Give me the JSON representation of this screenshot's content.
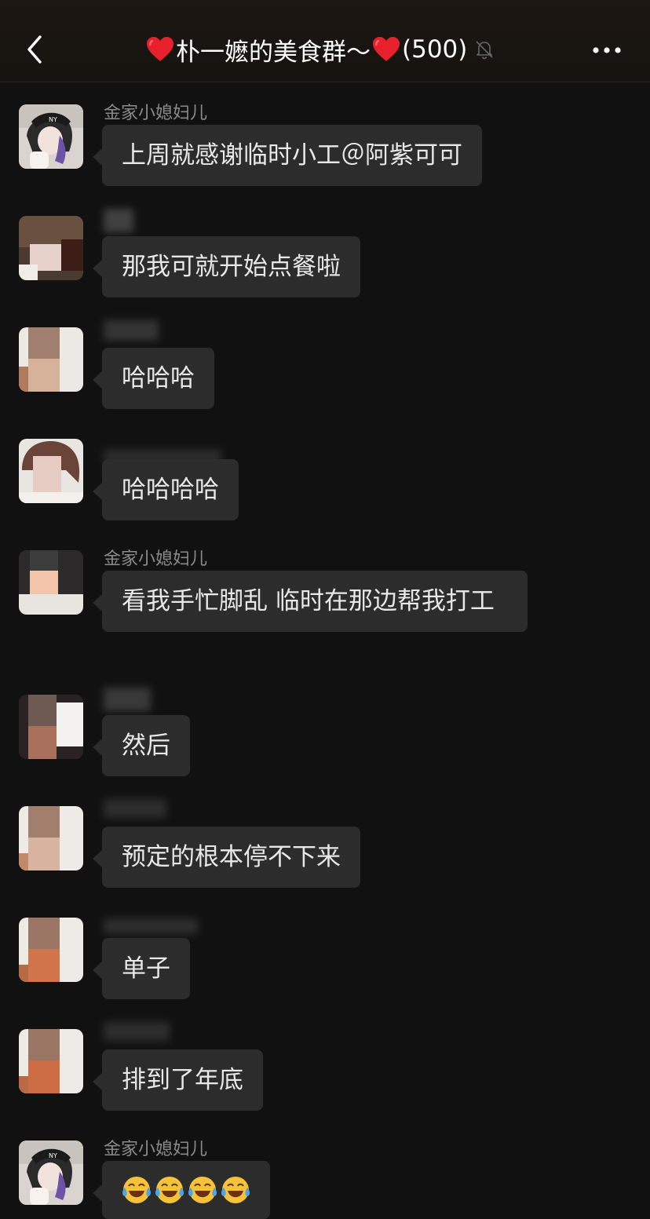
{
  "header": {
    "title": "朴一嬷的美食群～",
    "member_count": "(500)",
    "back_icon": "chevron-left-icon",
    "mute_icon": "bell-off-icon",
    "more_icon": "more-icon",
    "heart_color": "#e8202b"
  },
  "messages": [
    {
      "sender": "金家小媳妇儿",
      "text": "上周就感谢临时小工＠阿紫可可",
      "avatar": "avatar-girl-cap"
    },
    {
      "sender": "",
      "text": "那我可就开始点餐啦",
      "avatar": "avatar-blurred"
    },
    {
      "sender": "",
      "text": "哈哈哈",
      "avatar": "avatar-blurred"
    },
    {
      "sender": "",
      "text": "哈哈哈哈",
      "avatar": "avatar-blurred"
    },
    {
      "sender": "金家小媳妇儿",
      "text": "看我手忙脚乱 临时在那边帮我打工",
      "avatar": "avatar-blurred"
    },
    {
      "sender": "",
      "text": "然后",
      "avatar": "avatar-blurred"
    },
    {
      "sender": "",
      "text": "预定的根本停不下来",
      "avatar": "avatar-blurred"
    },
    {
      "sender": "",
      "text": "单子",
      "avatar": "avatar-blurred"
    },
    {
      "sender": "",
      "text": "排到了年底",
      "avatar": "avatar-blurred"
    },
    {
      "sender": "金家小媳妇儿",
      "text": "",
      "emojis": [
        "laugh-cry-emoji",
        "laugh-cry-emoji",
        "laugh-cry-emoji",
        "laugh-cry-emoji"
      ],
      "avatar": "avatar-girl-cap"
    }
  ]
}
